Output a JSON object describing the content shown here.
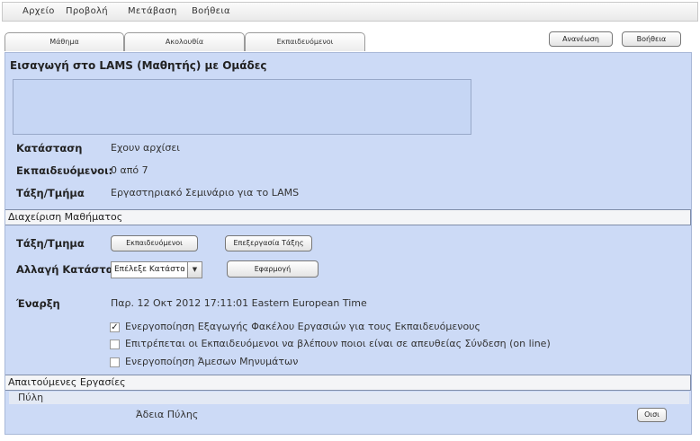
{
  "menu": [
    "Αρχείο",
    "Προβολή",
    "Μετάβαση",
    "Βοήθεια"
  ],
  "tabs": [
    "Μάθημα",
    "Ακολουθία",
    "Εκπαιδευόμενοι"
  ],
  "toolbar": {
    "refresh": "Ανανέωση",
    "help": "Βοήθεια"
  },
  "lesson": {
    "title": "Εισαγωγή στο LAMS (Μαθητής) με Ομάδες",
    "description": "",
    "status_label": "Κατάσταση",
    "status_value": "Εχουν αρχίσει",
    "learners_label": "Εκπαιδευόμενοι:",
    "learners_value": "0 από 7",
    "class_label": "Τάξη/Τμήμα",
    "class_value": "Εργαστηριακό Σεμινάριο για το LAMS"
  },
  "management": {
    "section_title": "Διαχείριση Μαθήματος",
    "class_label": "Τάξη/Τμημα",
    "learners_btn": "Εκπαιδευόμενοι",
    "edit_class_btn": "Επεξεργασία Τάξης",
    "change_status_label": "Αλλαγή Κατάστασης",
    "status_select": "Επέλεξε Κατάσταση",
    "apply_btn": "Εφαρμογή",
    "start_label": "Έναρξη",
    "start_value": "Παρ. 12 Οκτ 2012 17:11:01 Eastern European Time",
    "options": [
      {
        "label": "Ενεργοποίηση Εξαγωγής Φακέλου  Εργασιών για τους Εκπαιδευόμενους",
        "checked": true
      },
      {
        "label": "Επιτρέπεται οι Εκπαιδευόμενοι να βλέπουν ποιοι είναι σε απευθείας Σύνδεση (on line)",
        "checked": false
      },
      {
        "label": "Ενεργοποίηση Άμεσων Μηνυμάτων",
        "checked": false
      }
    ]
  },
  "required": {
    "section_title": "Απαιτούμενες Εργασίες",
    "gate_header": "Πύλη",
    "gate_name": "Άδεια Πύλης",
    "view_btn": "Οισι"
  },
  "colors": {
    "panel": "#ccdaf6",
    "section": "#f4f5f7",
    "gate_header": "#e3e9f4"
  }
}
